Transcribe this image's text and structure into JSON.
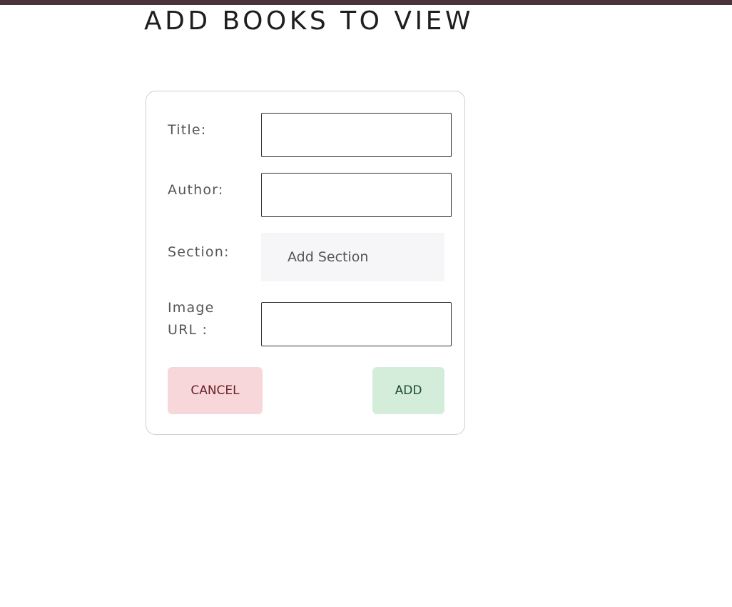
{
  "page": {
    "title": "ADD BOOKS TO VIEW"
  },
  "form": {
    "title_label": "Title:",
    "title_value": "",
    "author_label": "Author:",
    "author_value": "",
    "section_label": "Section:",
    "section_value": "Add Section",
    "image_label": "Image URL :",
    "image_value": ""
  },
  "buttons": {
    "cancel_label": "CANCEL",
    "add_label": "ADD"
  },
  "colors": {
    "top_bar": "#4a3439",
    "cancel_bg": "#f8d7da",
    "cancel_text": "#6b2329",
    "add_bg": "#d4eddb",
    "add_text": "#1f4a2a"
  }
}
